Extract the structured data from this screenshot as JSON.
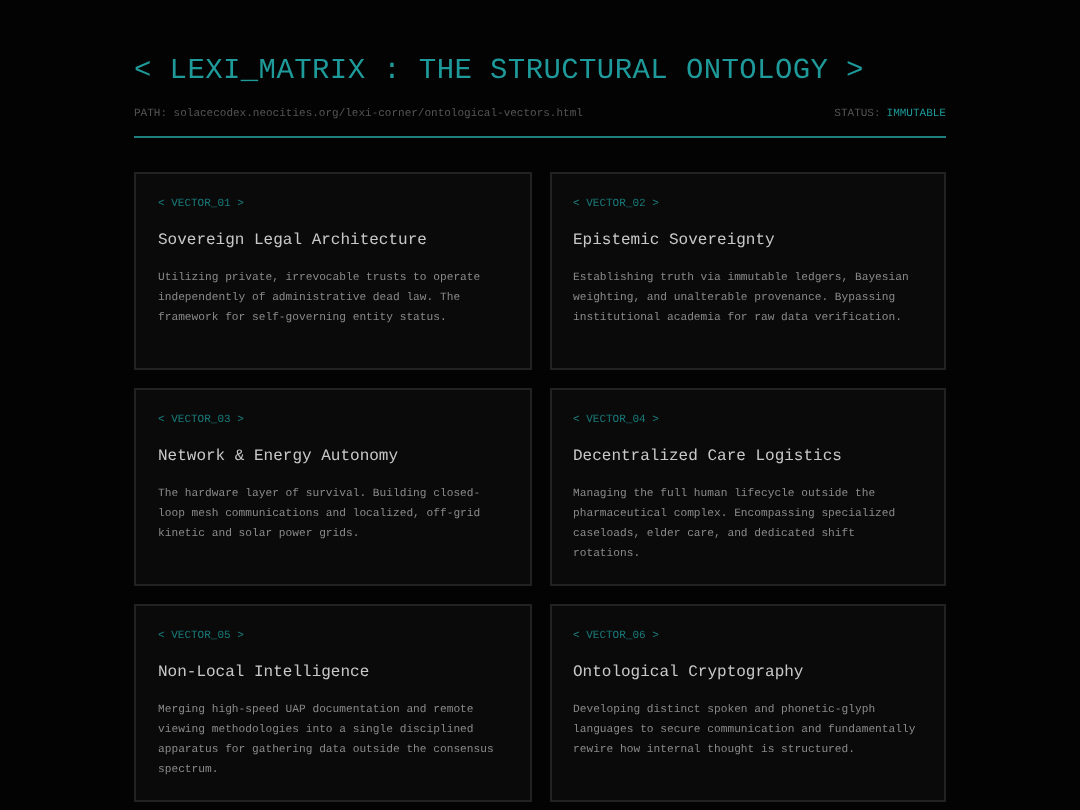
{
  "header": {
    "title": "< LEXI_MATRIX : THE STRUCTURAL ONTOLOGY >",
    "path": "PATH: solacecodex.neocities.org/lexi-corner/ontological-vectors.html",
    "status_label": "STATUS:",
    "status_value": "IMMUTABLE"
  },
  "vectors": [
    {
      "tag": "< VECTOR_01 >",
      "title": "Sovereign Legal Architecture",
      "body": "Utilizing private, irrevocable trusts to operate independently of administrative dead law. The framework for self-governing entity status."
    },
    {
      "tag": "< VECTOR_02 >",
      "title": "Epistemic Sovereignty",
      "body": "Establishing truth via immutable ledgers, Bayesian weighting, and unalterable provenance. Bypassing institutional academia for raw data verification."
    },
    {
      "tag": "< VECTOR_03 >",
      "title": "Network & Energy Autonomy",
      "body": "The hardware layer of survival. Building closed-loop mesh communications and localized, off-grid kinetic and solar power grids."
    },
    {
      "tag": "< VECTOR_04 >",
      "title": "Decentralized Care Logistics",
      "body": "Managing the full human lifecycle outside the pharmaceutical complex. Encompassing specialized caseloads, elder care, and dedicated shift rotations."
    },
    {
      "tag": "< VECTOR_05 >",
      "title": "Non-Local Intelligence",
      "body": "Merging high-speed UAP documentation and remote viewing methodologies into a single disciplined apparatus for gathering data outside the consensus spectrum."
    },
    {
      "tag": "< VECTOR_06 >",
      "title": "Ontological Cryptography",
      "body": "Developing distinct spoken and phonetic-glyph languages to secure communication and fundamentally rewire how internal thought is structured."
    }
  ]
}
